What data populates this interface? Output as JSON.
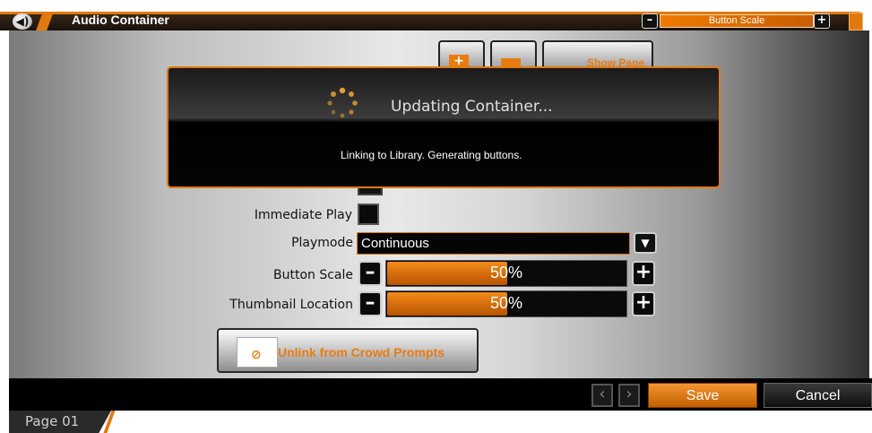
{
  "titlebar": {
    "title": "Audio Container",
    "button_scale_label": "Button Scale",
    "speaker_icon": "speaker-icon",
    "minus_icon": "minus-icon",
    "plus_icon": "plus-icon"
  },
  "toolbar": {
    "add_icon": "add-page-icon",
    "remove_icon": "remove-page-icon",
    "show_page_label": "Show Page"
  },
  "modal": {
    "title": "Updating Container...",
    "message": "Linking to Library. Generating buttons.",
    "spinner_icon": "loading-spinner-icon"
  },
  "form": {
    "immediate_play_label": "Immediate Play",
    "immediate_play_checked": false,
    "playmode_label": "Playmode",
    "playmode_value": "Continuous",
    "button_scale_label": "Button Scale",
    "button_scale_value": "50%",
    "button_scale_fraction": 0.5,
    "thumbnail_location_label": "Thumbnail Location",
    "thumbnail_location_value": "50%",
    "thumbnail_location_fraction": 0.5
  },
  "unlink_button": {
    "label": "Unlink from Crowd Prompts",
    "icon": "link-icon"
  },
  "footer": {
    "prev_icon": "chevron-left-icon",
    "next_icon": "chevron-right-icon",
    "save_label": "Save",
    "cancel_label": "Cancel",
    "page_tab": "Page 01"
  },
  "colors": {
    "accent": "#e07a10",
    "background_dark": "#000000"
  }
}
